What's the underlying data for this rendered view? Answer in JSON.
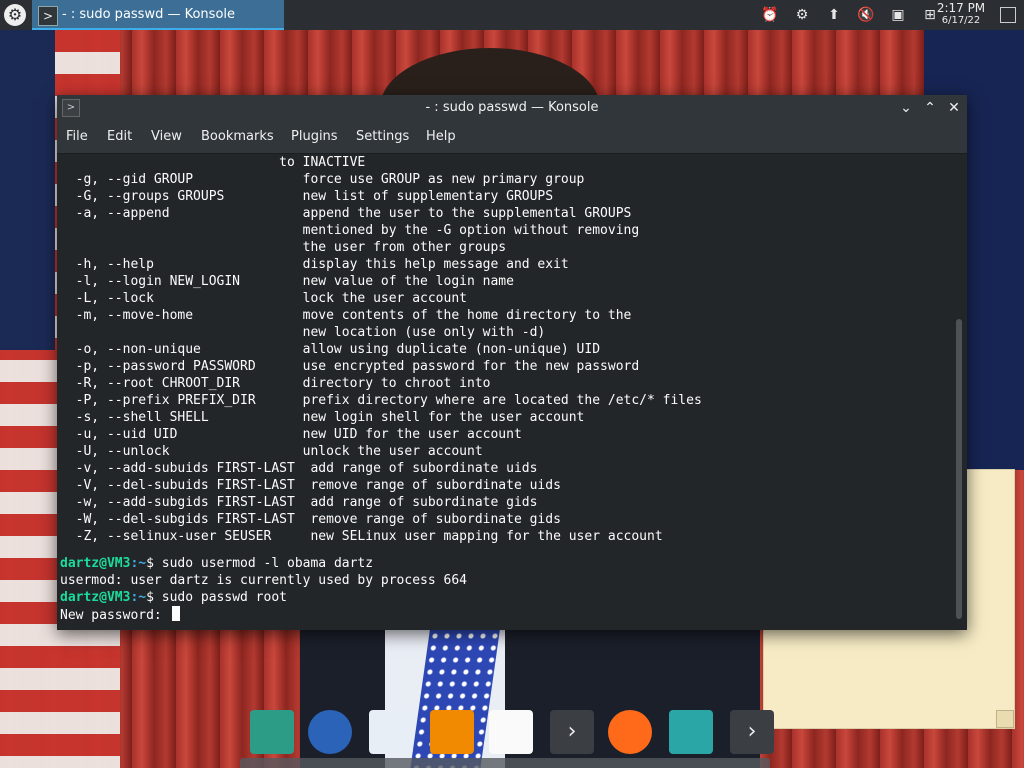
{
  "top_panel": {
    "task_title": "- : sudo passwd — Konsole",
    "tray_icons": [
      "updates-icon",
      "network-config-icon",
      "update-arrow-icon",
      "volume-muted-icon",
      "monitor-icon",
      "network-icon"
    ],
    "clock_time": "2:17 PM",
    "clock_date": "6/17/22"
  },
  "window": {
    "title": "- : sudo passwd — Konsole",
    "menu": [
      "File",
      "Edit",
      "View",
      "Bookmarks",
      "Plugins",
      "Settings",
      "Help"
    ]
  },
  "terminal": {
    "help_lines": [
      "                            to INACTIVE",
      "  -g, --gid GROUP              force use GROUP as new primary group",
      "  -G, --groups GROUPS          new list of supplementary GROUPS",
      "  -a, --append                 append the user to the supplemental GROUPS",
      "                               mentioned by the -G option without removing",
      "                               the user from other groups",
      "  -h, --help                   display this help message and exit",
      "  -l, --login NEW_LOGIN        new value of the login name",
      "  -L, --lock                   lock the user account",
      "  -m, --move-home              move contents of the home directory to the",
      "                               new location (use only with -d)",
      "  -o, --non-unique             allow using duplicate (non-unique) UID",
      "  -p, --password PASSWORD      use encrypted password for the new password",
      "  -R, --root CHROOT_DIR        directory to chroot into",
      "  -P, --prefix PREFIX_DIR      prefix directory where are located the /etc/* files",
      "  -s, --shell SHELL            new login shell for the user account",
      "  -u, --uid UID                new UID for the user account",
      "  -U, --unlock                 unlock the user account",
      "  -v, --add-subuids FIRST-LAST  add range of subordinate uids",
      "  -V, --del-subuids FIRST-LAST  remove range of subordinate uids",
      "  -w, --add-subgids FIRST-LAST  add range of subordinate gids",
      "  -W, --del-subgids FIRST-LAST  remove range of subordinate gids",
      "  -Z, --selinux-user SEUSER     new SELinux user mapping for the user account"
    ],
    "prompt_user": "dartz@VM3",
    "prompt_path": ":~",
    "prompt_symbol": "$ ",
    "command1": "sudo usermod -l obama dartz",
    "output1": "usermod: user dartz is currently used by process 664",
    "command2": "sudo passwd root",
    "password_prompt": "New password: "
  },
  "dock": {
    "items": [
      {
        "name": "tape-app-icon",
        "color": "#2d9c86"
      },
      {
        "name": "thunderbird-icon",
        "color": "#2a63b8"
      },
      {
        "name": "text-editor-icon",
        "color": "#e8eef6"
      },
      {
        "name": "vlc-icon",
        "color": "#f18a00"
      },
      {
        "name": "image-viewer-icon",
        "color": "#fafafa"
      },
      {
        "name": "terminal-icon",
        "color": "#3b3f44"
      },
      {
        "name": "firefox-icon",
        "color": "#ff6a1a"
      },
      {
        "name": "kde-connect-icon",
        "color": "#2aa6a6"
      },
      {
        "name": "konsole-icon",
        "color": "#3b3f44"
      }
    ]
  }
}
